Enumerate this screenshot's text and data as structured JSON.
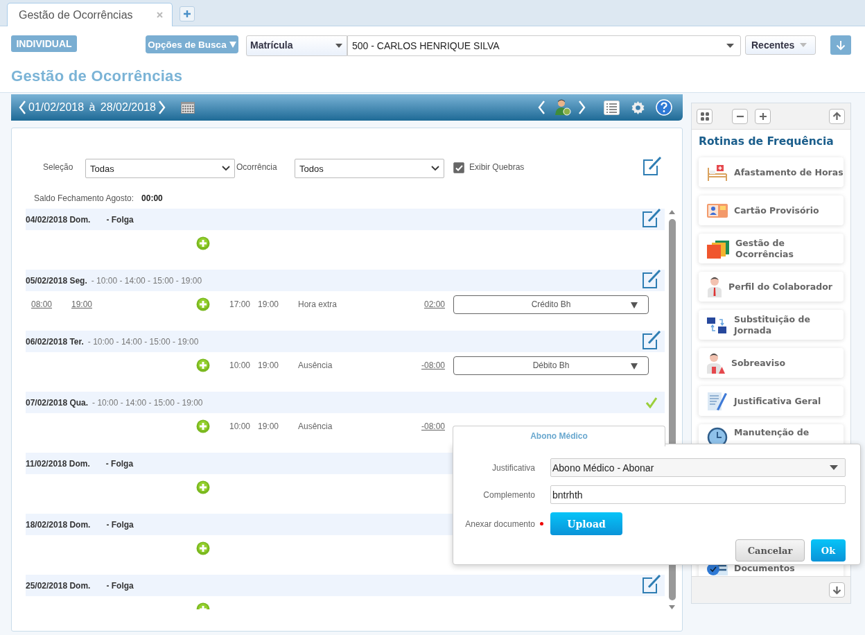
{
  "tabs": [
    {
      "label": "Gestão de Ocorrências",
      "selected": true
    }
  ],
  "toolbar": {
    "mode_button": "INDIVIDUAL",
    "search_options": "Opções de Busca",
    "search_type": "Matrícula",
    "employee": "500 - CARLOS HENRIQUE SILVA",
    "recent": "Recentes"
  },
  "page_title": "Gestão de Ocorrências",
  "period": {
    "range": "01/02/2018 à 28/02/2018"
  },
  "filters": {
    "selecao_label": "Seleção",
    "selecao_value": "Todas",
    "ocorrencia_label": "Ocorrência",
    "ocorrencia_value": "Todos",
    "show_breaks": {
      "label": "Exibir Quebras",
      "checked": true
    }
  },
  "balance": {
    "label": "Saldo Fechamento Agosto:",
    "value": "00:00"
  },
  "days": [
    {
      "date": "04/02/2018 Dom.",
      "schedule": "- Folga",
      "day_off": true,
      "approved": false
    },
    {
      "date": "05/02/2018 Seg.",
      "schedule": "- 10:00 - 14:00 - 15:00 - 19:00",
      "day_off": false,
      "approved": false,
      "entry": {
        "punches": [
          "08:00",
          "19:00"
        ],
        "start": "17:00",
        "end": "19:00",
        "type": "Hora extra",
        "balance": "02:00",
        "action": "Crédito Bh"
      }
    },
    {
      "date": "06/02/2018 Ter.",
      "schedule": "- 10:00 - 14:00 - 15:00 - 19:00",
      "day_off": false,
      "approved": false,
      "entry": {
        "start": "10:00",
        "end": "19:00",
        "type": "Ausência",
        "balance": "-08:00",
        "action": "Débito Bh"
      }
    },
    {
      "date": "07/02/2018 Qua.",
      "schedule": "- 10:00 - 14:00 - 15:00 - 19:00",
      "day_off": false,
      "approved": true,
      "entry": {
        "start": "10:00",
        "end": "19:00",
        "type": "Ausência",
        "balance": "-08:00"
      }
    },
    {
      "date": "11/02/2018 Dom.",
      "schedule": "- Folga",
      "day_off": true
    },
    {
      "date": "18/02/2018 Dom.",
      "schedule": "- Folga",
      "day_off": true
    },
    {
      "date": "25/02/2018 Dom.",
      "schedule": "- Folga",
      "day_off": true,
      "approved": false
    }
  ],
  "sidebar": {
    "title": "Rotinas de Frequência",
    "items": [
      {
        "label": "Afastamento de Horas",
        "kind": "bed"
      },
      {
        "label": "Cartão Provisório",
        "kind": "card"
      },
      {
        "label": "Gestão de Ocorrências",
        "kind": "folders"
      },
      {
        "label": "Perfil do Colaborador",
        "kind": "person"
      },
      {
        "label": "Substituição de Jornada",
        "kind": "swap"
      },
      {
        "label": "Sobreaviso",
        "kind": "alert"
      },
      {
        "label": "Justificativa Geral",
        "kind": "document"
      },
      {
        "label": "Manutenção de",
        "kind": "clock"
      },
      {
        "label": "Documentos",
        "kind": "checklist"
      }
    ]
  },
  "dialog": {
    "title": "Abono Médico",
    "fields": [
      {
        "kind": "select",
        "label": "Justificativa",
        "value": "Abono Médico - Abonar"
      },
      {
        "kind": "text",
        "label": "Complemento",
        "value": "bntrhth"
      },
      {
        "kind": "upload",
        "label": "Anexar documento",
        "required": true,
        "button": "Upload"
      }
    ],
    "buttons": [
      {
        "label": "Cancelar",
        "primary": false
      },
      {
        "label": "Ok",
        "primary": true
      }
    ]
  }
}
